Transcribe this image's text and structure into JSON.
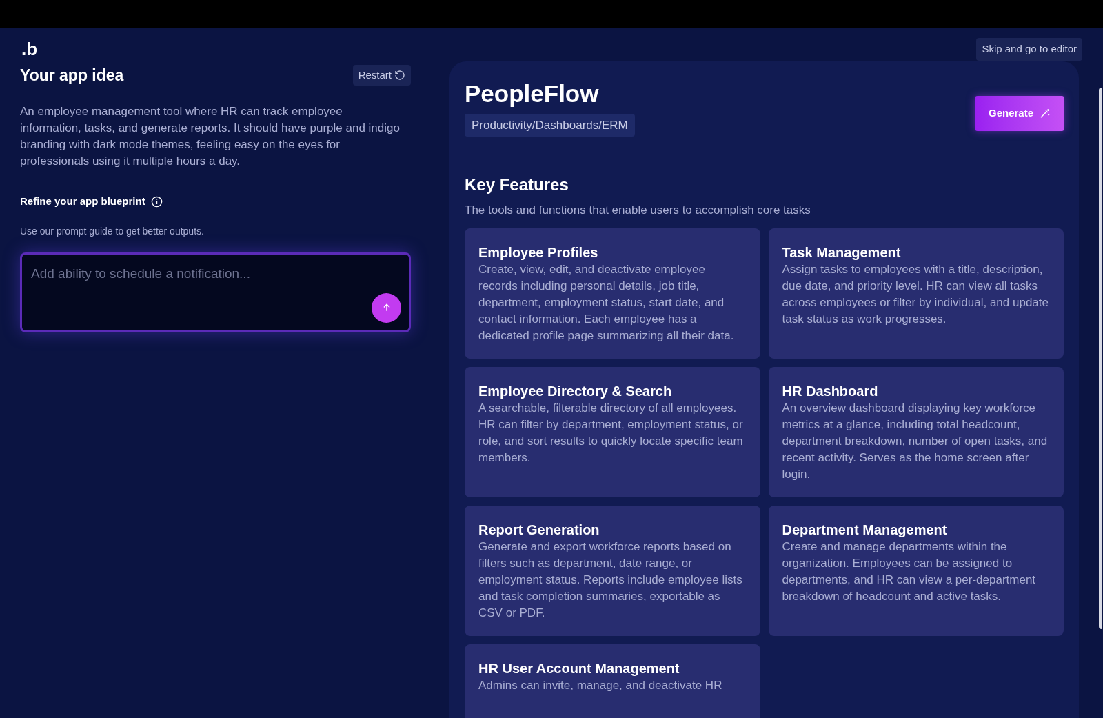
{
  "header": {
    "logo": ".b",
    "skip_button": "Skip and go to editor"
  },
  "idea": {
    "title": "Your app idea",
    "restart_button": "Restart",
    "description": "An employee management tool where HR can track employee information, tasks, and generate reports. It should have purple and indigo branding with dark mode themes, feeling easy on the eyes for professionals using it multiple hours a day.",
    "refine_label": "Refine your app blueprint",
    "hint": "Use our prompt guide to get better outputs.",
    "prompt": {
      "placeholder": "Add ability to schedule a notification..."
    }
  },
  "blueprint": {
    "app_name": "PeopleFlow",
    "category": "Productivity/Dashboards/ERM",
    "generate_button": "Generate",
    "section_title": "Key Features",
    "section_subtitle": "The tools and functions that enable users to accomplish core tasks",
    "features": [
      {
        "title": "Employee Profiles",
        "description": "Create, view, edit, and deactivate employee records including personal details, job title, department, employment status, start date, and contact information. Each employee has a dedicated profile page summarizing all their data."
      },
      {
        "title": "Task Management",
        "description": "Assign tasks to employees with a title, description, due date, and priority level. HR can view all tasks across employees or filter by individual, and update task status as work progresses."
      },
      {
        "title": "Employee Directory & Search",
        "description": "A searchable, filterable directory of all employees. HR can filter by department, employment status, or role, and sort results to quickly locate specific team members."
      },
      {
        "title": "HR Dashboard",
        "description": "An overview dashboard displaying key workforce metrics at a glance, including total headcount, department breakdown, number of open tasks, and recent activity. Serves as the home screen after login."
      },
      {
        "title": "Report Generation",
        "description": "Generate and export workforce reports based on filters such as department, date range, or employment status. Reports include employee lists and task completion summaries, exportable as CSV or PDF."
      },
      {
        "title": "Department Management",
        "description": "Create and manage departments within the organization. Employees can be assigned to departments, and HR can view a per-department breakdown of headcount and active tasks."
      },
      {
        "title": "HR User Account Management",
        "description": "Admins can invite, manage, and deactivate HR"
      }
    ]
  }
}
